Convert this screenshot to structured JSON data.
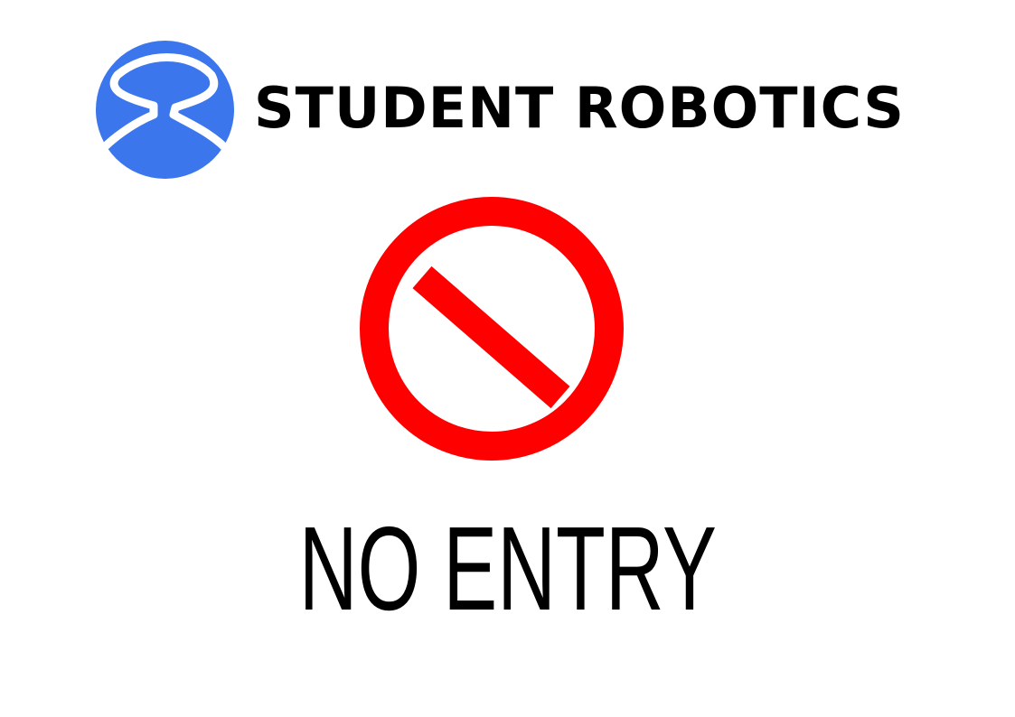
{
  "header": {
    "logo_icon": "student-robotics-logo",
    "brand_name": "STUDENT ROBOTICS"
  },
  "sign": {
    "symbol_icon": "no-entry-icon",
    "text": "NO ENTRY"
  },
  "colors": {
    "logo_blue": "#3b76ec",
    "prohibition_red": "#ff0000",
    "text": "#000000",
    "background": "#ffffff"
  }
}
